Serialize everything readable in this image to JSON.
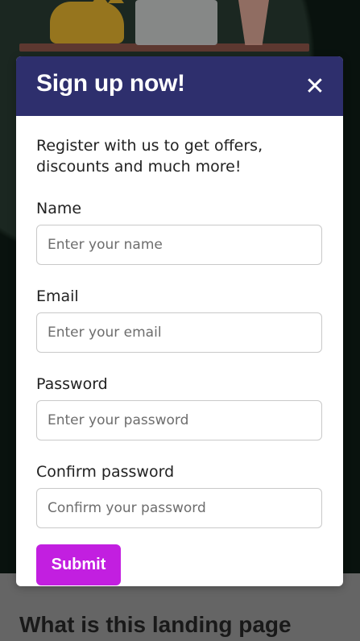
{
  "background": {
    "heading": "What is this landing page"
  },
  "modal": {
    "title": "Sign up now!",
    "close_symbol": "✕",
    "intro": "Register with us to get offers, discounts and much more!",
    "fields": [
      {
        "label": "Name",
        "placeholder": "Enter your name",
        "value": ""
      },
      {
        "label": "Email",
        "placeholder": "Enter your email",
        "value": ""
      },
      {
        "label": "Password",
        "placeholder": "Enter your password",
        "value": ""
      },
      {
        "label": "Confirm password",
        "placeholder": "Confirm your password",
        "value": ""
      }
    ],
    "submit_label": "Submit"
  },
  "colors": {
    "header_bg": "#2e2f6d",
    "submit_bg": "#c21fe0",
    "modal_bg": "#ffffff",
    "input_border": "#c9c9c9"
  },
  "icons": {
    "close": "close-icon"
  }
}
